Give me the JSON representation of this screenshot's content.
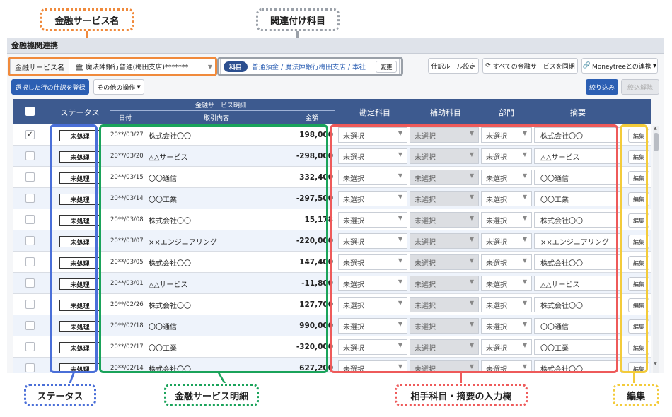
{
  "callouts": {
    "service_name": "金融サービス名",
    "linked_account": "関連付け科目",
    "status": "ステータス",
    "service_detail": "金融サービス明細",
    "input_area": "相手科目・摘要の入力欄",
    "edit": "編集"
  },
  "app": {
    "title": "金融機関連携",
    "service_label": "金融サービス名",
    "service_value": "🏛 魔法陣銀行普通(梅田支店)*******",
    "account_badge": "科目",
    "account_path": "普通預金 / 魔法陣銀行梅田支店 / 本社",
    "change_button": "変更",
    "rule_button": "仕訳ルール設定",
    "sync_button": "すべての金融サービスを同期",
    "moneytree_button": "Moneytreeとの連携",
    "register_button": "選択した行の仕訳を登録",
    "other_ops_button": "その他の操作",
    "filter_button": "絞り込み",
    "clear_filter_button": "絞込解除"
  },
  "table": {
    "headers": {
      "status": "ステータス",
      "detail_group": "金融サービス明細",
      "date": "日付",
      "description": "取引内容",
      "amount": "金額",
      "account": "勘定科目",
      "sub_account": "補助科目",
      "department": "部門",
      "memo": "摘要"
    },
    "select_placeholder": "未選択",
    "edit_label": "編集",
    "rows": [
      {
        "checked": true,
        "status": "未処理",
        "date": "20**/03/27",
        "desc": "株式会社〇〇",
        "amount": "198,000",
        "memo": "株式会社〇〇"
      },
      {
        "checked": false,
        "status": "未処理",
        "date": "20**/03/20",
        "desc": "△△サービス",
        "amount": "-298,000",
        "memo": "△△サービス"
      },
      {
        "checked": false,
        "status": "未処理",
        "date": "20**/03/15",
        "desc": "〇〇通信",
        "amount": "332,400",
        "memo": "〇〇通信"
      },
      {
        "checked": false,
        "status": "未処理",
        "date": "20**/03/14",
        "desc": "〇〇工業",
        "amount": "-297,500",
        "memo": "〇〇工業"
      },
      {
        "checked": false,
        "status": "未処理",
        "date": "20**/03/08",
        "desc": "株式会社〇〇",
        "amount": "15,178",
        "memo": "株式会社〇〇"
      },
      {
        "checked": false,
        "status": "未処理",
        "date": "20**/03/07",
        "desc": "××エンジニアリング",
        "amount": "-220,000",
        "memo": "××エンジニアリング"
      },
      {
        "checked": false,
        "status": "未処理",
        "date": "20**/03/05",
        "desc": "株式会社〇〇",
        "amount": "147,400",
        "memo": "株式会社〇〇"
      },
      {
        "checked": false,
        "status": "未処理",
        "date": "20**/03/01",
        "desc": "△△サービス",
        "amount": "-11,800",
        "memo": "△△サービス"
      },
      {
        "checked": false,
        "status": "未処理",
        "date": "20**/02/26",
        "desc": "株式会社〇〇",
        "amount": "127,700",
        "memo": "株式会社〇〇"
      },
      {
        "checked": false,
        "status": "未処理",
        "date": "20**/02/18",
        "desc": "〇〇通信",
        "amount": "990,000",
        "memo": "〇〇通信"
      },
      {
        "checked": false,
        "status": "未処理",
        "date": "20**/02/17",
        "desc": "〇〇工業",
        "amount": "-320,000",
        "memo": "〇〇工業"
      },
      {
        "checked": false,
        "status": "未処理",
        "date": "20**/02/14",
        "desc": "株式会社〇〇",
        "amount": "627,200",
        "memo": "株式会社〇〇"
      }
    ]
  },
  "colors": {
    "orange": "#f08a3c",
    "gray": "#9aa0a8",
    "blue": "#4a6fd8",
    "green": "#1aa35a",
    "red": "#ee5a5a",
    "yellow": "#f3cb3a"
  }
}
